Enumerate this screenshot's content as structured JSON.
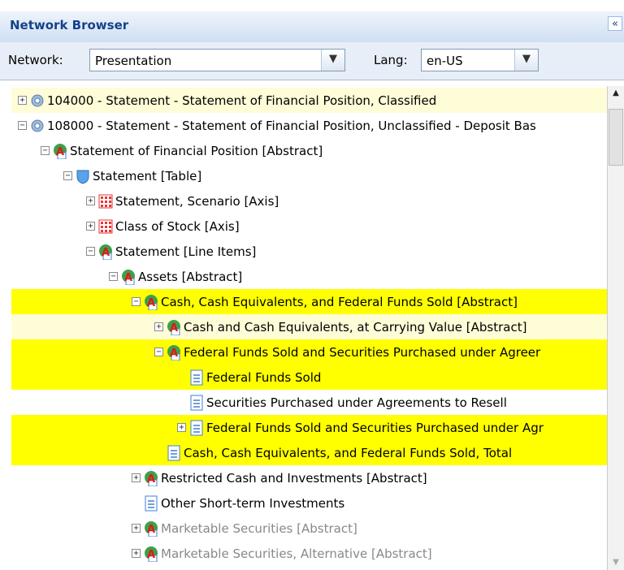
{
  "panel": {
    "title": "Network Browser",
    "collapse_glyph": "«"
  },
  "filters": {
    "network_label": "Network:",
    "network_value": "Presentation",
    "lang_label": "Lang:",
    "lang_value": "en-US"
  },
  "tree": [
    {
      "label": "104000 - Statement - Statement of Financial Position, Classified",
      "depth": 0,
      "icon": "gear-icon",
      "expander": "+",
      "highlight": "pale"
    },
    {
      "label": "108000 - Statement - Statement of Financial Position, Unclassified - Deposit Bas",
      "depth": 0,
      "icon": "gear-icon",
      "expander": "-",
      "highlight": "none"
    },
    {
      "label": "Statement of Financial Position [Abstract]",
      "depth": 1,
      "icon": "abstract-icon",
      "expander": "-",
      "highlight": "none"
    },
    {
      "label": "Statement [Table]",
      "depth": 2,
      "icon": "table-icon",
      "expander": "-",
      "highlight": "none"
    },
    {
      "label": "Statement, Scenario [Axis]",
      "depth": 3,
      "icon": "axis-icon",
      "expander": "+",
      "highlight": "none"
    },
    {
      "label": "Class of Stock [Axis]",
      "depth": 3,
      "icon": "axis-icon",
      "expander": "+",
      "highlight": "none"
    },
    {
      "label": "Statement [Line Items]",
      "depth": 3,
      "icon": "abstract-icon",
      "expander": "-",
      "highlight": "none"
    },
    {
      "label": "Assets [Abstract]",
      "depth": 4,
      "icon": "abstract-icon",
      "expander": "-",
      "highlight": "none"
    },
    {
      "label": "Cash, Cash Equivalents, and Federal Funds Sold [Abstract]",
      "depth": 5,
      "icon": "abstract-icon",
      "expander": "-",
      "highlight": "yellow"
    },
    {
      "label": "Cash and Cash Equivalents, at Carrying Value [Abstract]",
      "depth": 6,
      "icon": "abstract-icon",
      "expander": "+",
      "highlight": "pale"
    },
    {
      "label": "Federal Funds Sold and Securities Purchased under Agreer",
      "depth": 6,
      "icon": "abstract-icon",
      "expander": "-",
      "highlight": "yellow"
    },
    {
      "label": "Federal Funds Sold",
      "depth": 7,
      "icon": "document-icon",
      "expander": "",
      "highlight": "yellow"
    },
    {
      "label": "Securities Purchased under Agreements to Resell",
      "depth": 7,
      "icon": "document-icon",
      "expander": "",
      "highlight": "none"
    },
    {
      "label": "Federal Funds Sold and Securities Purchased under Agr",
      "depth": 7,
      "icon": "document-icon",
      "expander": "+",
      "highlight": "yellow"
    },
    {
      "label": "Cash, Cash Equivalents, and Federal Funds Sold, Total",
      "depth": 6,
      "icon": "document-icon",
      "expander": "",
      "highlight": "yellow"
    },
    {
      "label": "Restricted Cash and Investments [Abstract]",
      "depth": 5,
      "icon": "abstract-icon",
      "expander": "+",
      "highlight": "none"
    },
    {
      "label": "Other Short-term Investments",
      "depth": 5,
      "icon": "document-icon",
      "expander": "",
      "highlight": "none"
    },
    {
      "label": "Marketable Securities [Abstract]",
      "depth": 5,
      "icon": "abstract-icon",
      "expander": "+",
      "highlight": "none",
      "dim": true
    },
    {
      "label": "Marketable Securities, Alternative [Abstract]",
      "depth": 5,
      "icon": "abstract-icon",
      "expander": "+",
      "highlight": "none",
      "dim": true
    }
  ]
}
